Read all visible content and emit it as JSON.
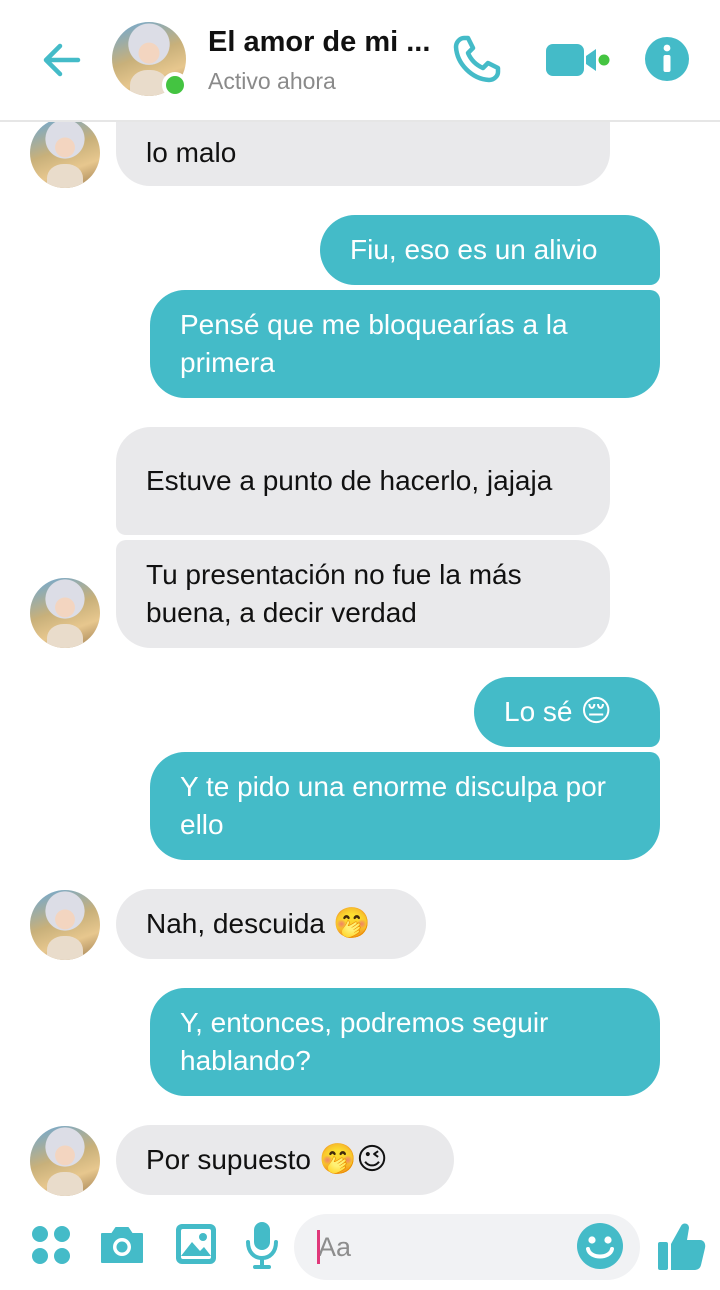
{
  "header": {
    "title": "El amor de mi ...",
    "status": "Activo ahora",
    "icons": [
      "back-arrow-icon",
      "phone-icon",
      "video-camera-icon",
      "info-icon"
    ],
    "accent_color": "#44bbc8",
    "online_color": "#44c441"
  },
  "messages": [
    {
      "side": "in",
      "text": "lo malo"
    },
    {
      "side": "out",
      "text": "Fiu, eso es un alivio"
    },
    {
      "side": "out",
      "text": "Pensé que me bloquearías a la primera"
    },
    {
      "side": "in",
      "text": "Estuve a punto de hacerlo, jajaja"
    },
    {
      "side": "in",
      "text": "Tu presentación no fue la más buena, a decir verdad"
    },
    {
      "side": "out",
      "text": "Lo sé",
      "emoji": "😔"
    },
    {
      "side": "out",
      "text": "Y te pido una enorme disculpa por ello"
    },
    {
      "side": "in",
      "text": "Nah, descuida",
      "emoji": "🤭"
    },
    {
      "side": "out",
      "text": "Y, entonces, podremos seguir hablando?"
    },
    {
      "side": "in",
      "text": "Por supuesto",
      "emoji": "🤭😉"
    }
  ],
  "composer": {
    "placeholder": "Aa",
    "icons": [
      "apps-grid-icon",
      "camera-icon",
      "image-icon",
      "microphone-icon",
      "emoji-icon",
      "thumbs-up-icon"
    ]
  }
}
